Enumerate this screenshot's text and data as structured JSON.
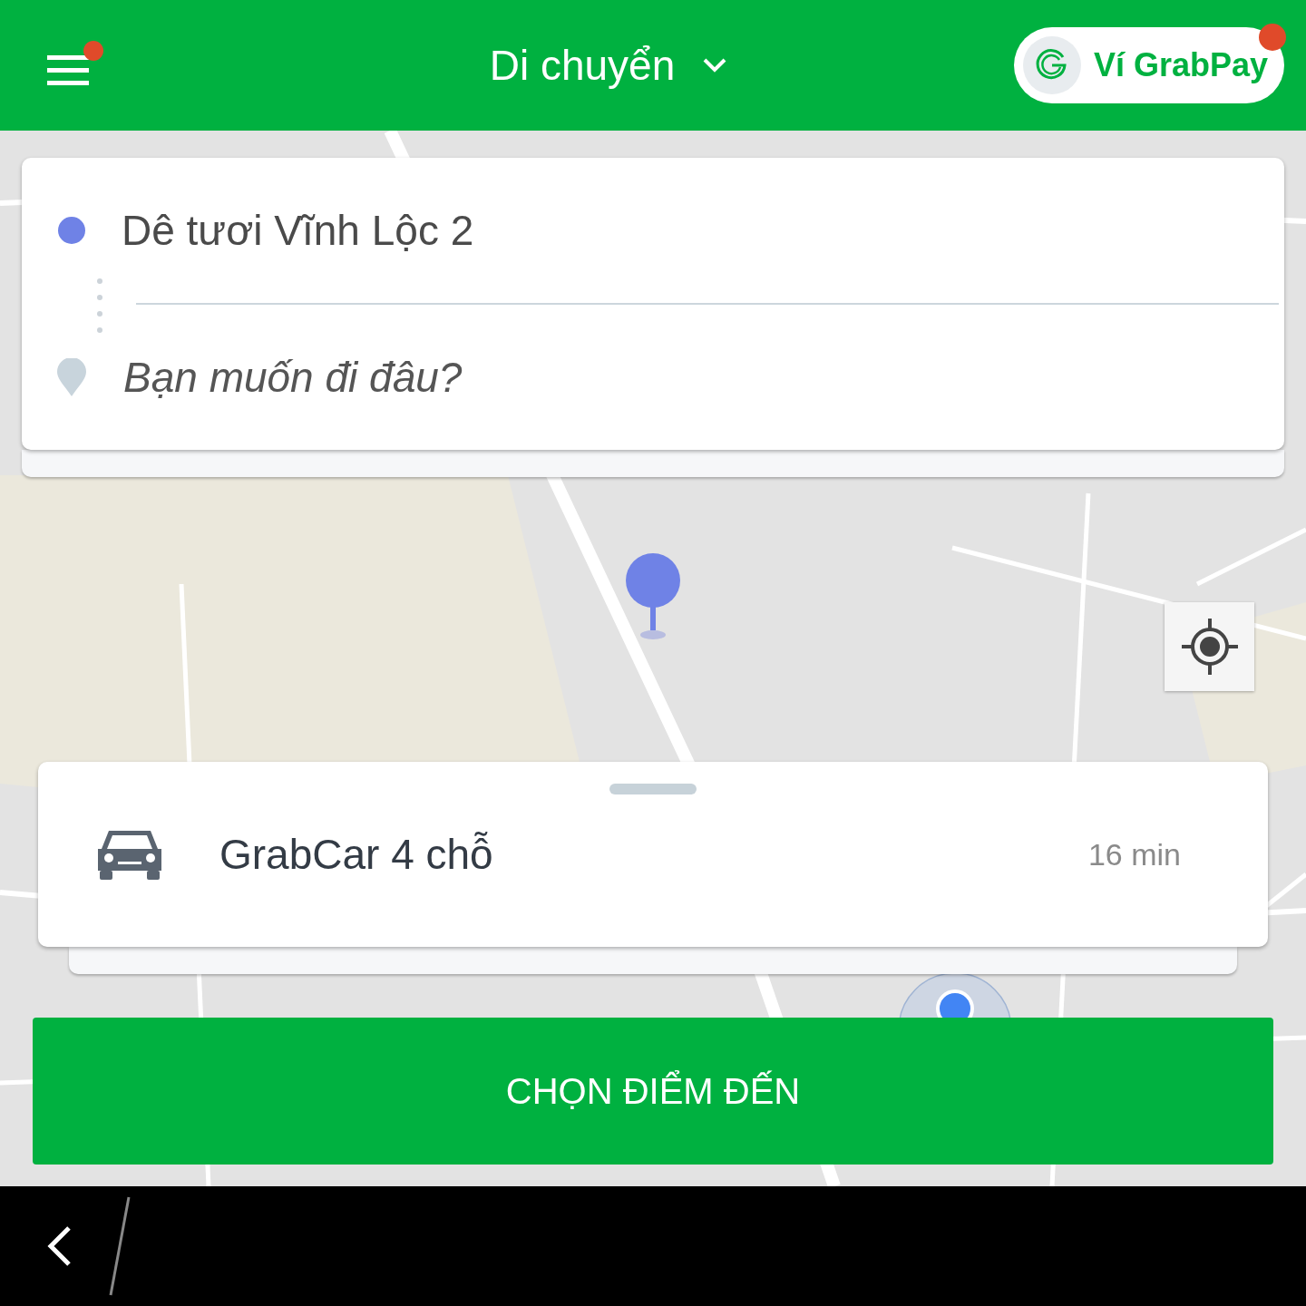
{
  "header": {
    "menu": {
      "notification": true
    },
    "title": "Di chuyển",
    "wallet": {
      "label": "Ví GrabPay",
      "notification": true
    }
  },
  "route": {
    "pickup": "Dê tươi Vĩnh Lộc 2",
    "destination": {
      "placeholder": "Bạn muốn đi đâu?"
    }
  },
  "vehicle": {
    "name": "GrabCar 4 chỗ",
    "eta": "16 min"
  },
  "action_button": "CHỌN ĐIỂM ĐẾN"
}
